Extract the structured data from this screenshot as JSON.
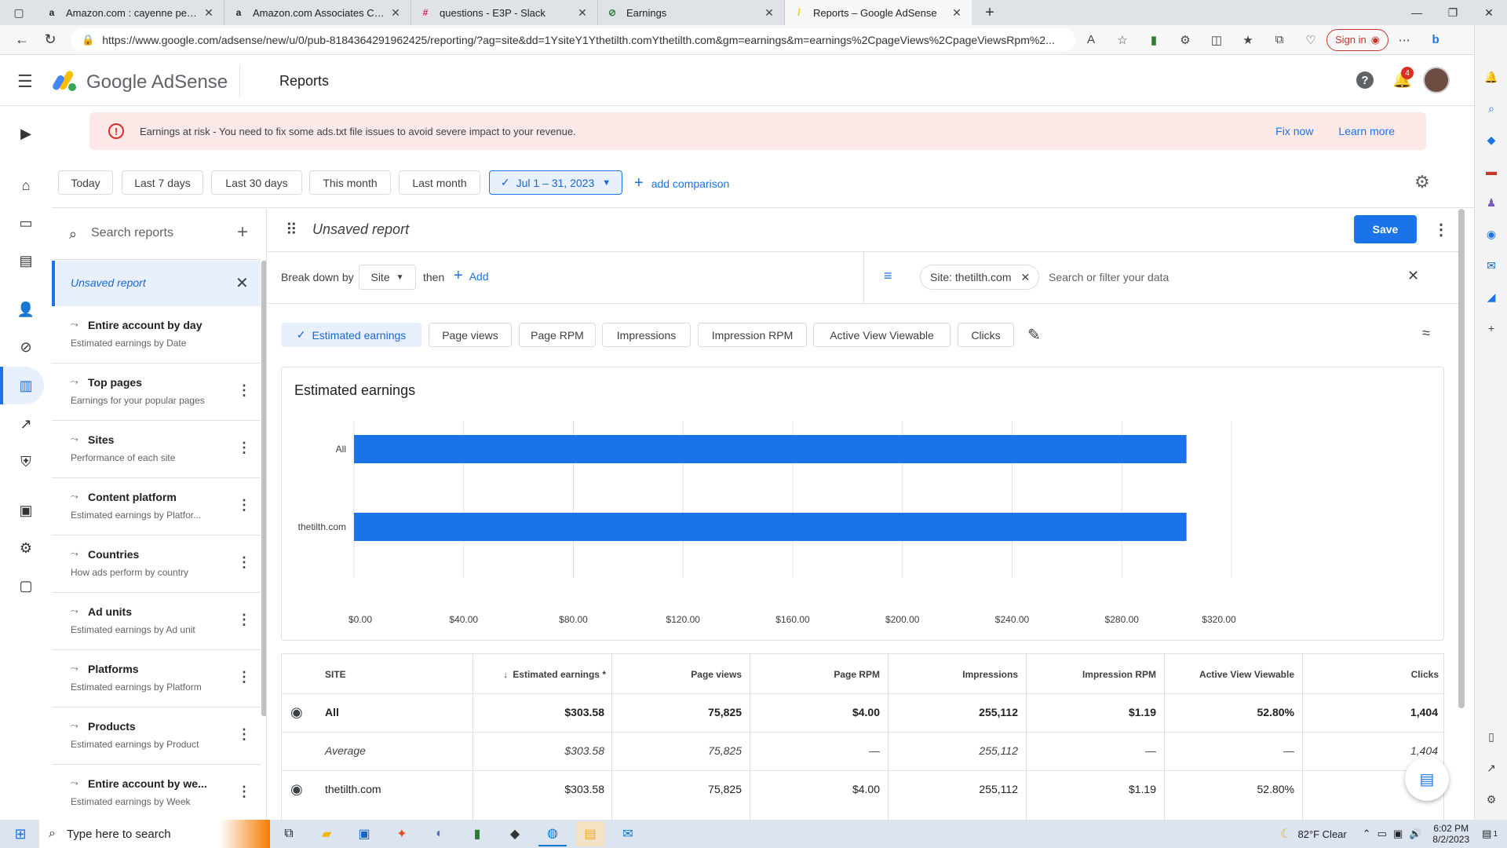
{
  "browser": {
    "tabs": [
      {
        "title": "Amazon.com : cayenne pepper b",
        "icon": "a"
      },
      {
        "title": "Amazon.com Associates Central",
        "icon": "a"
      },
      {
        "title": "questions - E3P - Slack",
        "icon": "#"
      },
      {
        "title": "Earnings",
        "icon": "⊘"
      },
      {
        "title": "Reports – Google AdSense",
        "icon": "/"
      }
    ],
    "url": "https://www.google.com/adsense/new/u/0/pub-8184364291962425/reporting/?ag=site&dd=1YsiteY1Ythetilth.comYthetilth.com&gm=earnings&m=earnings%2CpageViews%2CpageViewsRpm%2...",
    "signin_label": "Sign in"
  },
  "header": {
    "logo_text": "Google AdSense",
    "page_title": "Reports",
    "notification_count": "4"
  },
  "banner": {
    "message": "Earnings at risk - You need to fix some ads.txt file issues to avoid severe impact to your revenue.",
    "fix_label": "Fix now",
    "learn_label": "Learn more"
  },
  "date_range": {
    "options": [
      "Today",
      "Last 7 days",
      "Last 30 days",
      "This month",
      "Last month"
    ],
    "selected": "Jul 1 – 31, 2023",
    "add_comparison": "add comparison"
  },
  "sidebar": {
    "search_placeholder": "Search reports",
    "current": "Unsaved report",
    "items": [
      {
        "title": "Entire account by day",
        "subtitle": "Estimated earnings by Date"
      },
      {
        "title": "Top pages",
        "subtitle": "Earnings for your popular pages"
      },
      {
        "title": "Sites",
        "subtitle": "Performance of each site"
      },
      {
        "title": "Content platform",
        "subtitle": "Estimated earnings by Platfor..."
      },
      {
        "title": "Countries",
        "subtitle": "How ads perform by country"
      },
      {
        "title": "Ad units",
        "subtitle": "Estimated earnings by Ad unit"
      },
      {
        "title": "Platforms",
        "subtitle": "Estimated earnings by Platform"
      },
      {
        "title": "Products",
        "subtitle": "Estimated earnings by Product"
      },
      {
        "title": "Entire account by we...",
        "subtitle": "Estimated earnings by Week"
      }
    ]
  },
  "report": {
    "title": "Unsaved report",
    "save_label": "Save",
    "breakdown_label": "Break down by",
    "breakdown_value": "Site",
    "then_label": "then",
    "add_label": "Add",
    "filter_chip": "Site: thetilth.com",
    "filter_placeholder": "Search or filter your data",
    "metrics": [
      "Estimated earnings",
      "Page views",
      "Page RPM",
      "Impressions",
      "Impression RPM",
      "Active View Viewable",
      "Clicks"
    ]
  },
  "chart_data": {
    "type": "bar",
    "title": "Estimated earnings",
    "categories": [
      "All",
      "thetilth.com"
    ],
    "values": [
      303.58,
      303.58
    ],
    "xticks": [
      "$0.00",
      "$40.00",
      "$80.00",
      "$120.00",
      "$160.00",
      "$200.00",
      "$240.00",
      "$280.00",
      "$320.00"
    ],
    "xlim": [
      0,
      320
    ],
    "color": "#1a73e8",
    "orientation": "horizontal"
  },
  "table": {
    "headers": [
      "SITE",
      "Estimated earnings *",
      "Page views",
      "Page RPM",
      "Impressions",
      "Impression RPM",
      "Active View Viewable",
      "Clicks"
    ],
    "rows": [
      {
        "cells": [
          "All",
          "$303.58",
          "75,825",
          "$4.00",
          "255,112",
          "$1.19",
          "52.80%",
          "1,404"
        ]
      },
      {
        "cells": [
          "Average",
          "$303.58",
          "75,825",
          "—",
          "255,112",
          "—",
          "—",
          "1,404"
        ]
      },
      {
        "cells": [
          "thetilth.com",
          "$303.58",
          "75,825",
          "$4.00",
          "255,112",
          "$1.19",
          "52.80%",
          ""
        ]
      }
    ]
  },
  "taskbar": {
    "search_placeholder": "Type here to search",
    "weather": "82°F  Clear",
    "time": "6:02 PM",
    "date": "8/2/2023",
    "notif": "1"
  }
}
